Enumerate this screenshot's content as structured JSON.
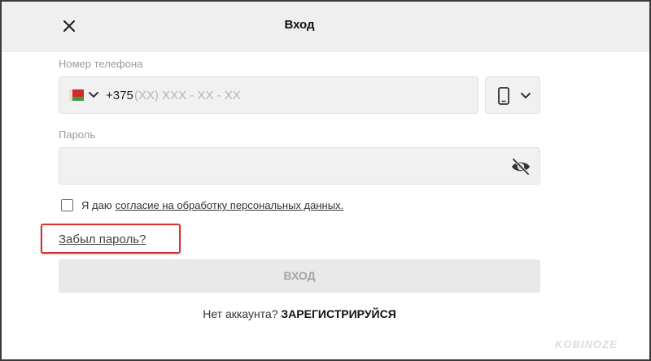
{
  "header": {
    "title": "Вход",
    "close_icon": "close-icon"
  },
  "phone": {
    "label": "Номер телефона",
    "country_flag": "belarus-flag",
    "prefix": "+375",
    "mask": "(XX) XXX - XX - XX",
    "device_icon": "mobile-phone-icon"
  },
  "password": {
    "label": "Пароль",
    "value": "",
    "visibility_icon": "eye-off-icon"
  },
  "consent": {
    "checked": false,
    "text": "Я даю",
    "link": "согласие на обработку персональных данных."
  },
  "forgot": {
    "label": "Забыл пароль?",
    "highlight_color": "#d63031"
  },
  "login_button": {
    "label": "ВХОД"
  },
  "register": {
    "prompt": "Нет аккаунта?",
    "link": "ЗАРЕГИСТРИРУЙСЯ"
  },
  "watermark": {
    "text": "KOBINOZE"
  },
  "colors": {
    "header_bg": "#efefef",
    "input_bg": "#f1f1f1",
    "button_bg": "#e9e9e9",
    "button_text": "#a5a5a5"
  }
}
